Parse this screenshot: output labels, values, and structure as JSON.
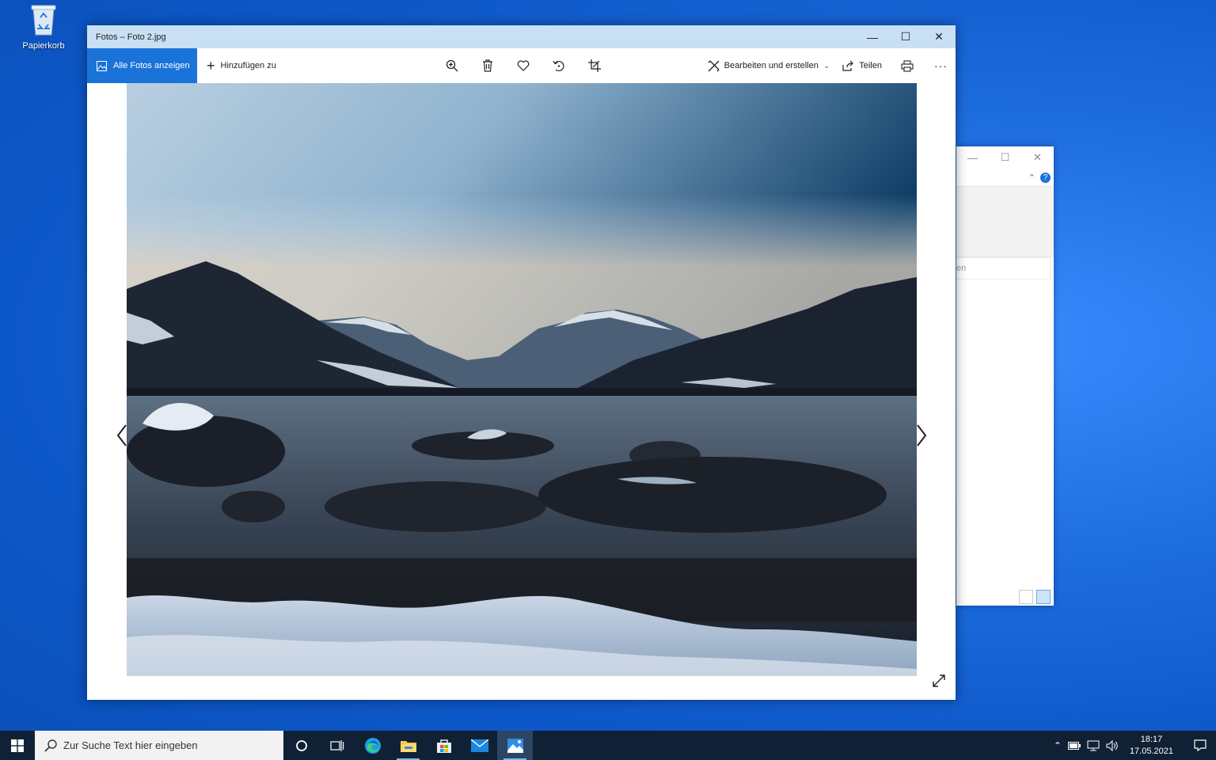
{
  "desktop": {
    "recycle_bin_label": "Papierkorb"
  },
  "photos_window": {
    "title": "Fotos – Foto 2.jpg",
    "toolbar": {
      "show_all_label": "Alle Fotos anzeigen",
      "add_to_label": "Hinzufügen zu",
      "edit_create_label": "Bearbeiten und erstellen",
      "share_label": "Teilen"
    },
    "colors": {
      "accent": "#1a73d9",
      "titlebar": "#c8dff4"
    }
  },
  "background_window": {
    "field_text": "en"
  },
  "taskbar": {
    "search_placeholder": "Zur Suche Text hier eingeben",
    "time": "18:17",
    "date": "17.05.2021"
  }
}
